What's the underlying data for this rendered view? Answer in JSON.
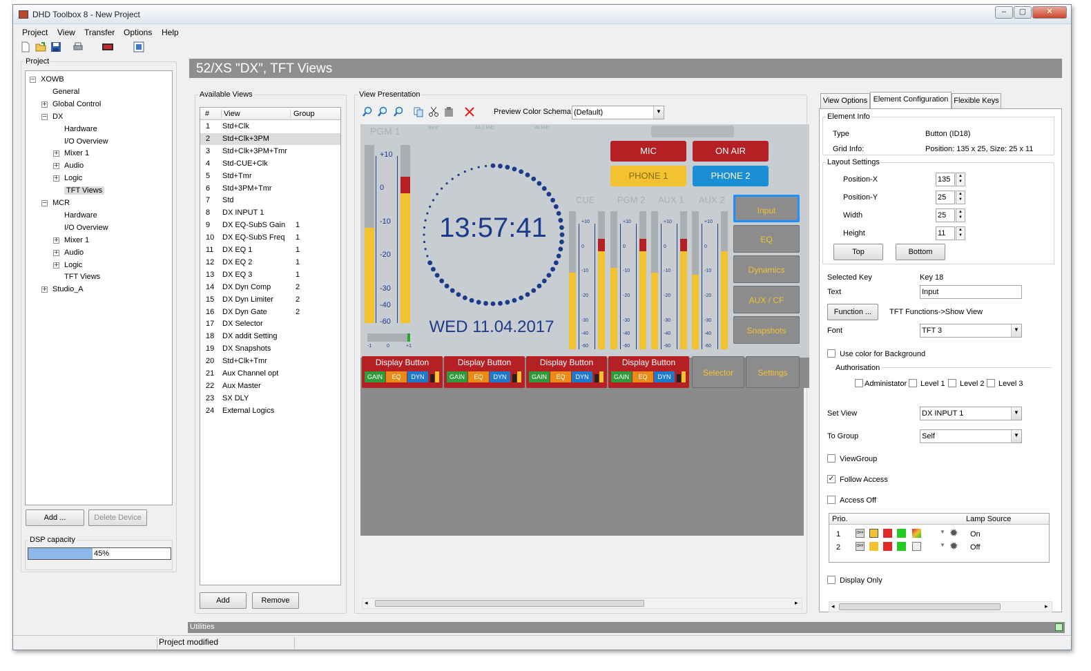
{
  "window": {
    "title": "DHD Toolbox 8 - New Project"
  },
  "menu": [
    "Project",
    "View",
    "Transfer",
    "Options",
    "Help"
  ],
  "project_panel": {
    "label": "Project",
    "tree": [
      {
        "text": "XOWB",
        "level": 0,
        "expander": "-"
      },
      {
        "text": "General",
        "level": 1,
        "expander": ""
      },
      {
        "text": "Global Control",
        "level": 1,
        "expander": "+"
      },
      {
        "text": "DX",
        "level": 1,
        "expander": "-"
      },
      {
        "text": "Hardware",
        "level": 2,
        "expander": ""
      },
      {
        "text": "I/O Overview",
        "level": 2,
        "expander": ""
      },
      {
        "text": "Mixer 1",
        "level": 2,
        "expander": "+"
      },
      {
        "text": "Audio",
        "level": 2,
        "expander": "+"
      },
      {
        "text": "Logic",
        "level": 2,
        "expander": "+"
      },
      {
        "text": "TFT Views",
        "level": 2,
        "expander": "",
        "selected": true
      },
      {
        "text": "MCR",
        "level": 1,
        "expander": "-"
      },
      {
        "text": "Hardware",
        "level": 2,
        "expander": ""
      },
      {
        "text": "I/O Overview",
        "level": 2,
        "expander": ""
      },
      {
        "text": "Mixer 1",
        "level": 2,
        "expander": "+"
      },
      {
        "text": "Audio",
        "level": 2,
        "expander": "+"
      },
      {
        "text": "Logic",
        "level": 2,
        "expander": "+"
      },
      {
        "text": "TFT Views",
        "level": 2,
        "expander": ""
      },
      {
        "text": "Studio_A",
        "level": 1,
        "expander": "+"
      }
    ],
    "add_label": "Add ...",
    "delete_label": "Delete Device",
    "dsp_label": "DSP capacity",
    "dsp_value": "45%",
    "dsp_fraction": 0.45
  },
  "page_header": "52/XS \"DX\", TFT Views",
  "available_views": {
    "label": "Available Views",
    "columns": [
      "#",
      "View",
      "Group"
    ],
    "rows": [
      {
        "n": "1",
        "view": "Std+Clk",
        "group": ""
      },
      {
        "n": "2",
        "view": "Std+Clk+3PM",
        "group": "",
        "selected": true
      },
      {
        "n": "3",
        "view": "Std+Clk+3PM+Tmr",
        "group": ""
      },
      {
        "n": "4",
        "view": "Std-CUE+Clk",
        "group": ""
      },
      {
        "n": "5",
        "view": "Std+Tmr",
        "group": ""
      },
      {
        "n": "6",
        "view": "Std+3PM+Tmr",
        "group": ""
      },
      {
        "n": "7",
        "view": "Std",
        "group": ""
      },
      {
        "n": "8",
        "view": "DX INPUT 1",
        "group": ""
      },
      {
        "n": "9",
        "view": "DX EQ-SubS Gain",
        "group": "1"
      },
      {
        "n": "10",
        "view": "DX EQ-SubS Freq",
        "group": "1"
      },
      {
        "n": "11",
        "view": "DX EQ 1",
        "group": "1"
      },
      {
        "n": "12",
        "view": "DX EQ 2",
        "group": "1"
      },
      {
        "n": "13",
        "view": "DX EQ 3",
        "group": "1"
      },
      {
        "n": "14",
        "view": "DX Dyn Comp",
        "group": "2"
      },
      {
        "n": "15",
        "view": "DX Dyn Limiter",
        "group": "2"
      },
      {
        "n": "16",
        "view": "DX Dyn Gate",
        "group": "2"
      },
      {
        "n": "17",
        "view": "DX Selector",
        "group": ""
      },
      {
        "n": "18",
        "view": "DX addit Setting",
        "group": ""
      },
      {
        "n": "19",
        "view": "DX Snapshots",
        "group": ""
      },
      {
        "n": "20",
        "view": "Std+Clk+Tmr",
        "group": ""
      },
      {
        "n": "21",
        "view": "Aux Channel opt",
        "group": ""
      },
      {
        "n": "22",
        "view": "Aux Master",
        "group": ""
      },
      {
        "n": "23",
        "view": "SX DLY",
        "group": ""
      },
      {
        "n": "24",
        "view": "External Logics",
        "group": ""
      }
    ],
    "add_label": "Add",
    "remove_label": "Remove"
  },
  "presentation": {
    "label": "View Presentation",
    "schema_label": "Preview Color Schema:",
    "schema_value": "(Default)",
    "tft": {
      "pgm1": "PGM 1",
      "sync": "Sync",
      "rate1": "44,1 kHz",
      "rate2": "48 kHz",
      "scale_main": [
        "+10",
        "0",
        "-10",
        "-20",
        "-30",
        "-40",
        "-60"
      ],
      "scale_small": [
        "+10",
        "0",
        "-10",
        "-20",
        "-30",
        "-40",
        "-60"
      ],
      "balance": [
        "-1",
        "0",
        "+1"
      ],
      "clock_time": "13:57:41",
      "clock_date": "WED 11.04.2017",
      "buttons": {
        "mic": "MIC",
        "on_air": "ON AIR",
        "phone1": "PHONE 1",
        "phone2": "PHONE 2"
      },
      "meters": [
        "CUE",
        "PGM 2",
        "AUX 1",
        "AUX 2"
      ],
      "side_buttons": [
        "Input",
        "EQ",
        "Dynamics",
        "AUX / CF",
        "Snapshots"
      ],
      "display_button": "Display Button",
      "tags": [
        "GAIN",
        "EQ",
        "DYN"
      ],
      "bottom_buttons": [
        "Selector",
        "Settings"
      ],
      "colors": {
        "red": "#b52025",
        "yellow": "#f2c230",
        "blue": "#1a8fd6",
        "clock": "#1b3a8a"
      }
    }
  },
  "tabs": [
    "View Options",
    "Element Configuration",
    "Flexible Keys"
  ],
  "config": {
    "element_info_label": "Element Info",
    "type_label": "Type",
    "type_value": "Button (ID18)",
    "grid_label": "Grid Info:",
    "grid_value": "Position: 135 x 25, Size: 25 x 11",
    "layout_label": "Layout Settings",
    "posx_label": "Position-X",
    "posx": "135",
    "posy_label": "Position-Y",
    "posy": "25",
    "width_label": "Width",
    "width": "25",
    "height_label": "Height",
    "height": "11",
    "top_label": "Top",
    "bottom_label": "Bottom",
    "selected_key_label": "Selected Key",
    "selected_key": "Key 18",
    "text_label": "Text",
    "text_value": "Input",
    "function_label": "Function ...",
    "function_value": "TFT Functions->Show View",
    "font_label": "Font",
    "font_value": "TFT 3",
    "use_color_label": "Use color for Background",
    "auth_label": "Authorisation",
    "auth": [
      "Administator",
      "Level 1",
      "Level 2",
      "Level 3"
    ],
    "set_view_label": "Set View",
    "set_view": "DX INPUT 1",
    "to_group_label": "To Group",
    "to_group": "Self",
    "viewgroup_label": "ViewGroup",
    "follow_label": "Follow Access",
    "access_off_label": "Access Off",
    "prio_header": "Prio.",
    "lamp_header": "Lamp Source",
    "lamp_rows": [
      {
        "prio": "1",
        "state": "On"
      },
      {
        "prio": "2",
        "state": "Off"
      }
    ],
    "off_tag": "OFF",
    "display_only_label": "Display Only"
  },
  "utilities_label": "Utilities",
  "status": "Project modified"
}
